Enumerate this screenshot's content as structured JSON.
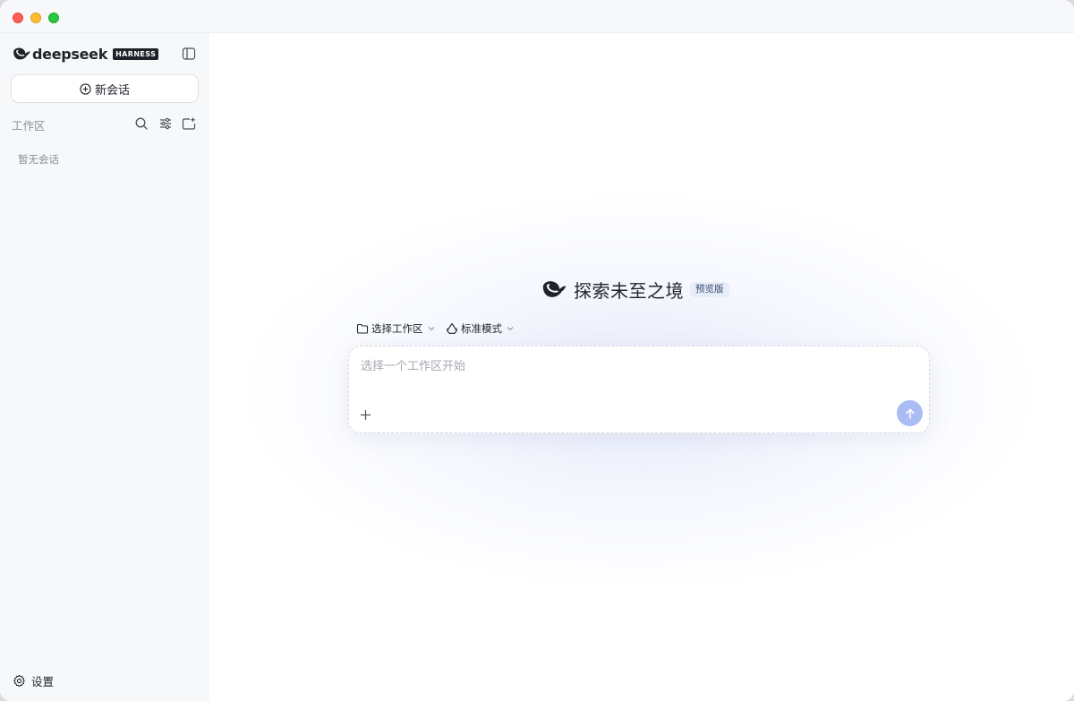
{
  "sidebar": {
    "brand_name": "deepseek",
    "brand_badge": "HARNESS",
    "new_chat_label": "新会话",
    "workspace_label": "工作区",
    "empty_text": "暂无会话",
    "settings_label": "设置"
  },
  "main": {
    "hero_title": "探索未至之境",
    "preview_badge": "预览版",
    "workspace_selector_label": "选择工作区",
    "mode_selector_label": "标准模式",
    "composer_placeholder": "选择一个工作区开始",
    "composer_value": ""
  },
  "colors": {
    "send_button": "#a9bcf3",
    "badge_bg": "#e6ecfa",
    "sidebar_bg": "#f7f8fa"
  },
  "icons": [
    "whale-logo",
    "sidebar-toggle-icon",
    "plus-circle-icon",
    "search-icon",
    "filter-icon",
    "new-folder-icon",
    "gear-icon",
    "folder-icon",
    "mode-icon",
    "chevron-down-icon",
    "plus-icon",
    "arrow-up-icon"
  ]
}
